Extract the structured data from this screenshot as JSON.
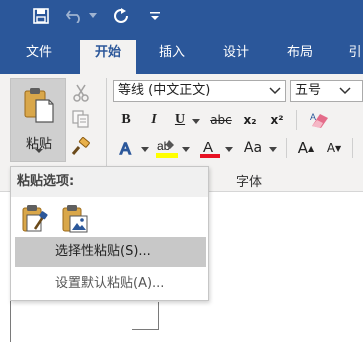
{
  "quick_access": {
    "save": "save-icon",
    "undo": "undo-icon",
    "redo": "redo-icon",
    "customize": "customize-toolbar-icon"
  },
  "tabs": [
    {
      "label": "文件"
    },
    {
      "label": "开始"
    },
    {
      "label": "插入"
    },
    {
      "label": "设计"
    },
    {
      "label": "布局"
    },
    {
      "label": "引"
    }
  ],
  "ribbon": {
    "paste_label": "粘贴",
    "font_name": "等线 (中文正文)",
    "font_size": "五号",
    "bold": "B",
    "italic": "I",
    "underline": "U",
    "strikethrough": "abc",
    "subscript": "x₂",
    "superscript": "x²",
    "change_case": "Aa",
    "grow_font": "A",
    "shrink_font": "A",
    "font_group_label": "字体",
    "colors": {
      "highlight": "#ffff00",
      "font_color": "#e81123",
      "accent": "#2b579a"
    }
  },
  "paste_menu": {
    "header": "粘贴选项:",
    "items": [
      {
        "label": "选择性粘贴(S)..."
      },
      {
        "label": "设置默认粘贴(A)..."
      }
    ]
  }
}
